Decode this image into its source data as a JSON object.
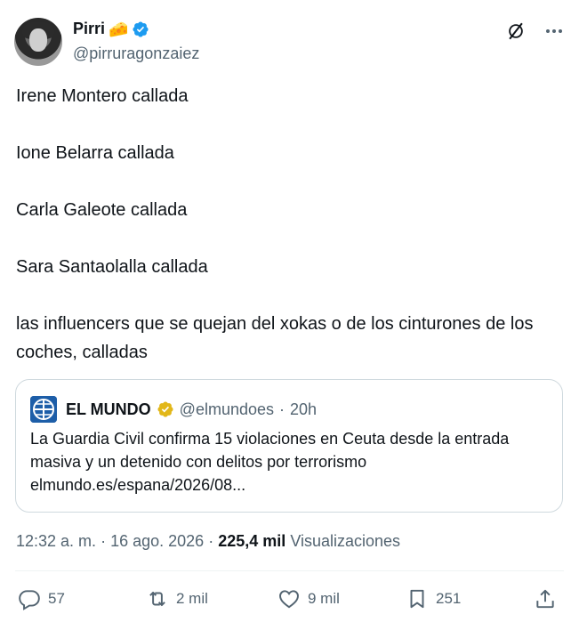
{
  "author": {
    "name": "Pirri",
    "name_emoji": "🧀",
    "handle": "@pirruragonzaiez",
    "verified_color": "#1d9bf0"
  },
  "body": {
    "lines": [
      "Irene Montero callada",
      "Ione Belarra callada",
      "Carla Galeote callada",
      "Sara Santaolalla callada",
      "las influencers que se quejan del xokas o de los cinturones de los coches, calladas"
    ]
  },
  "quoted_post": {
    "name": "EL MUNDO",
    "handle": "@elmundoes",
    "separator": "·",
    "time": "20h",
    "verified_color": "#e2b719",
    "text": "La Guardia Civil confirma 15 violaciones en Ceuta desde la entrada masiva y un detenido con delitos por terrorismo elmundo.es/espana/2026/08..."
  },
  "meta": {
    "time": "12:32 a. m.",
    "dot1": "·",
    "date": "16 ago. 2026",
    "dot2": "·",
    "views_count": "225,4 mil",
    "views_label": "Visualizaciones"
  },
  "actions": {
    "replies": "57",
    "reposts": "2 mil",
    "likes": "9 mil",
    "bookmarks": "251"
  },
  "icons": [
    "grok-icon",
    "more-icon",
    "reply-icon",
    "repost-icon",
    "like-icon",
    "bookmark-icon",
    "share-icon"
  ],
  "colors": {
    "text": "#0f1419",
    "muted": "#536471",
    "border": "#cfd9de",
    "brand": "#1d9bf0"
  }
}
